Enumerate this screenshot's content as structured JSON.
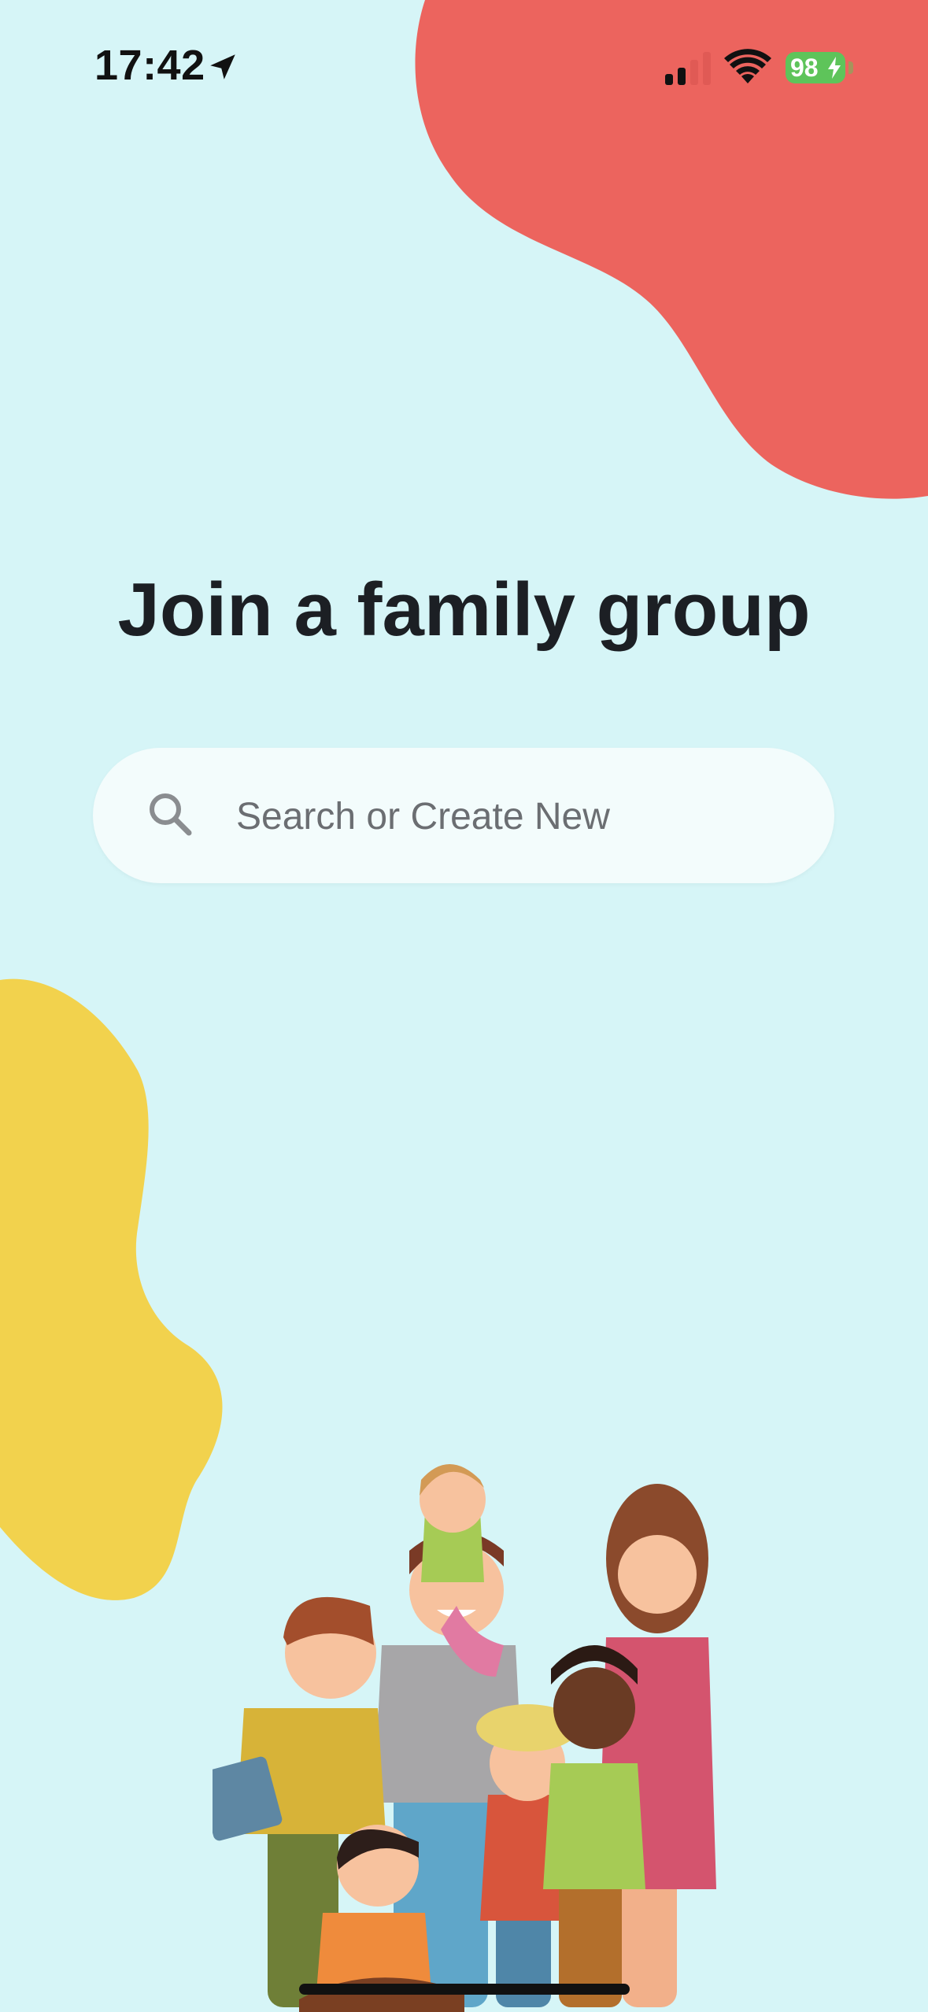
{
  "status_bar": {
    "time": "17:42",
    "battery": "98"
  },
  "main": {
    "title": "Join a family group",
    "search_placeholder": "Search or Create New"
  },
  "colors": {
    "background": "#d6f5f7",
    "red_blob": "#ec645e",
    "yellow_blob": "#f2d24d",
    "battery": "#5ec45a"
  },
  "icons": [
    "location-arrow-icon",
    "signal-icon",
    "wifi-icon",
    "battery-icon",
    "search-icon"
  ]
}
